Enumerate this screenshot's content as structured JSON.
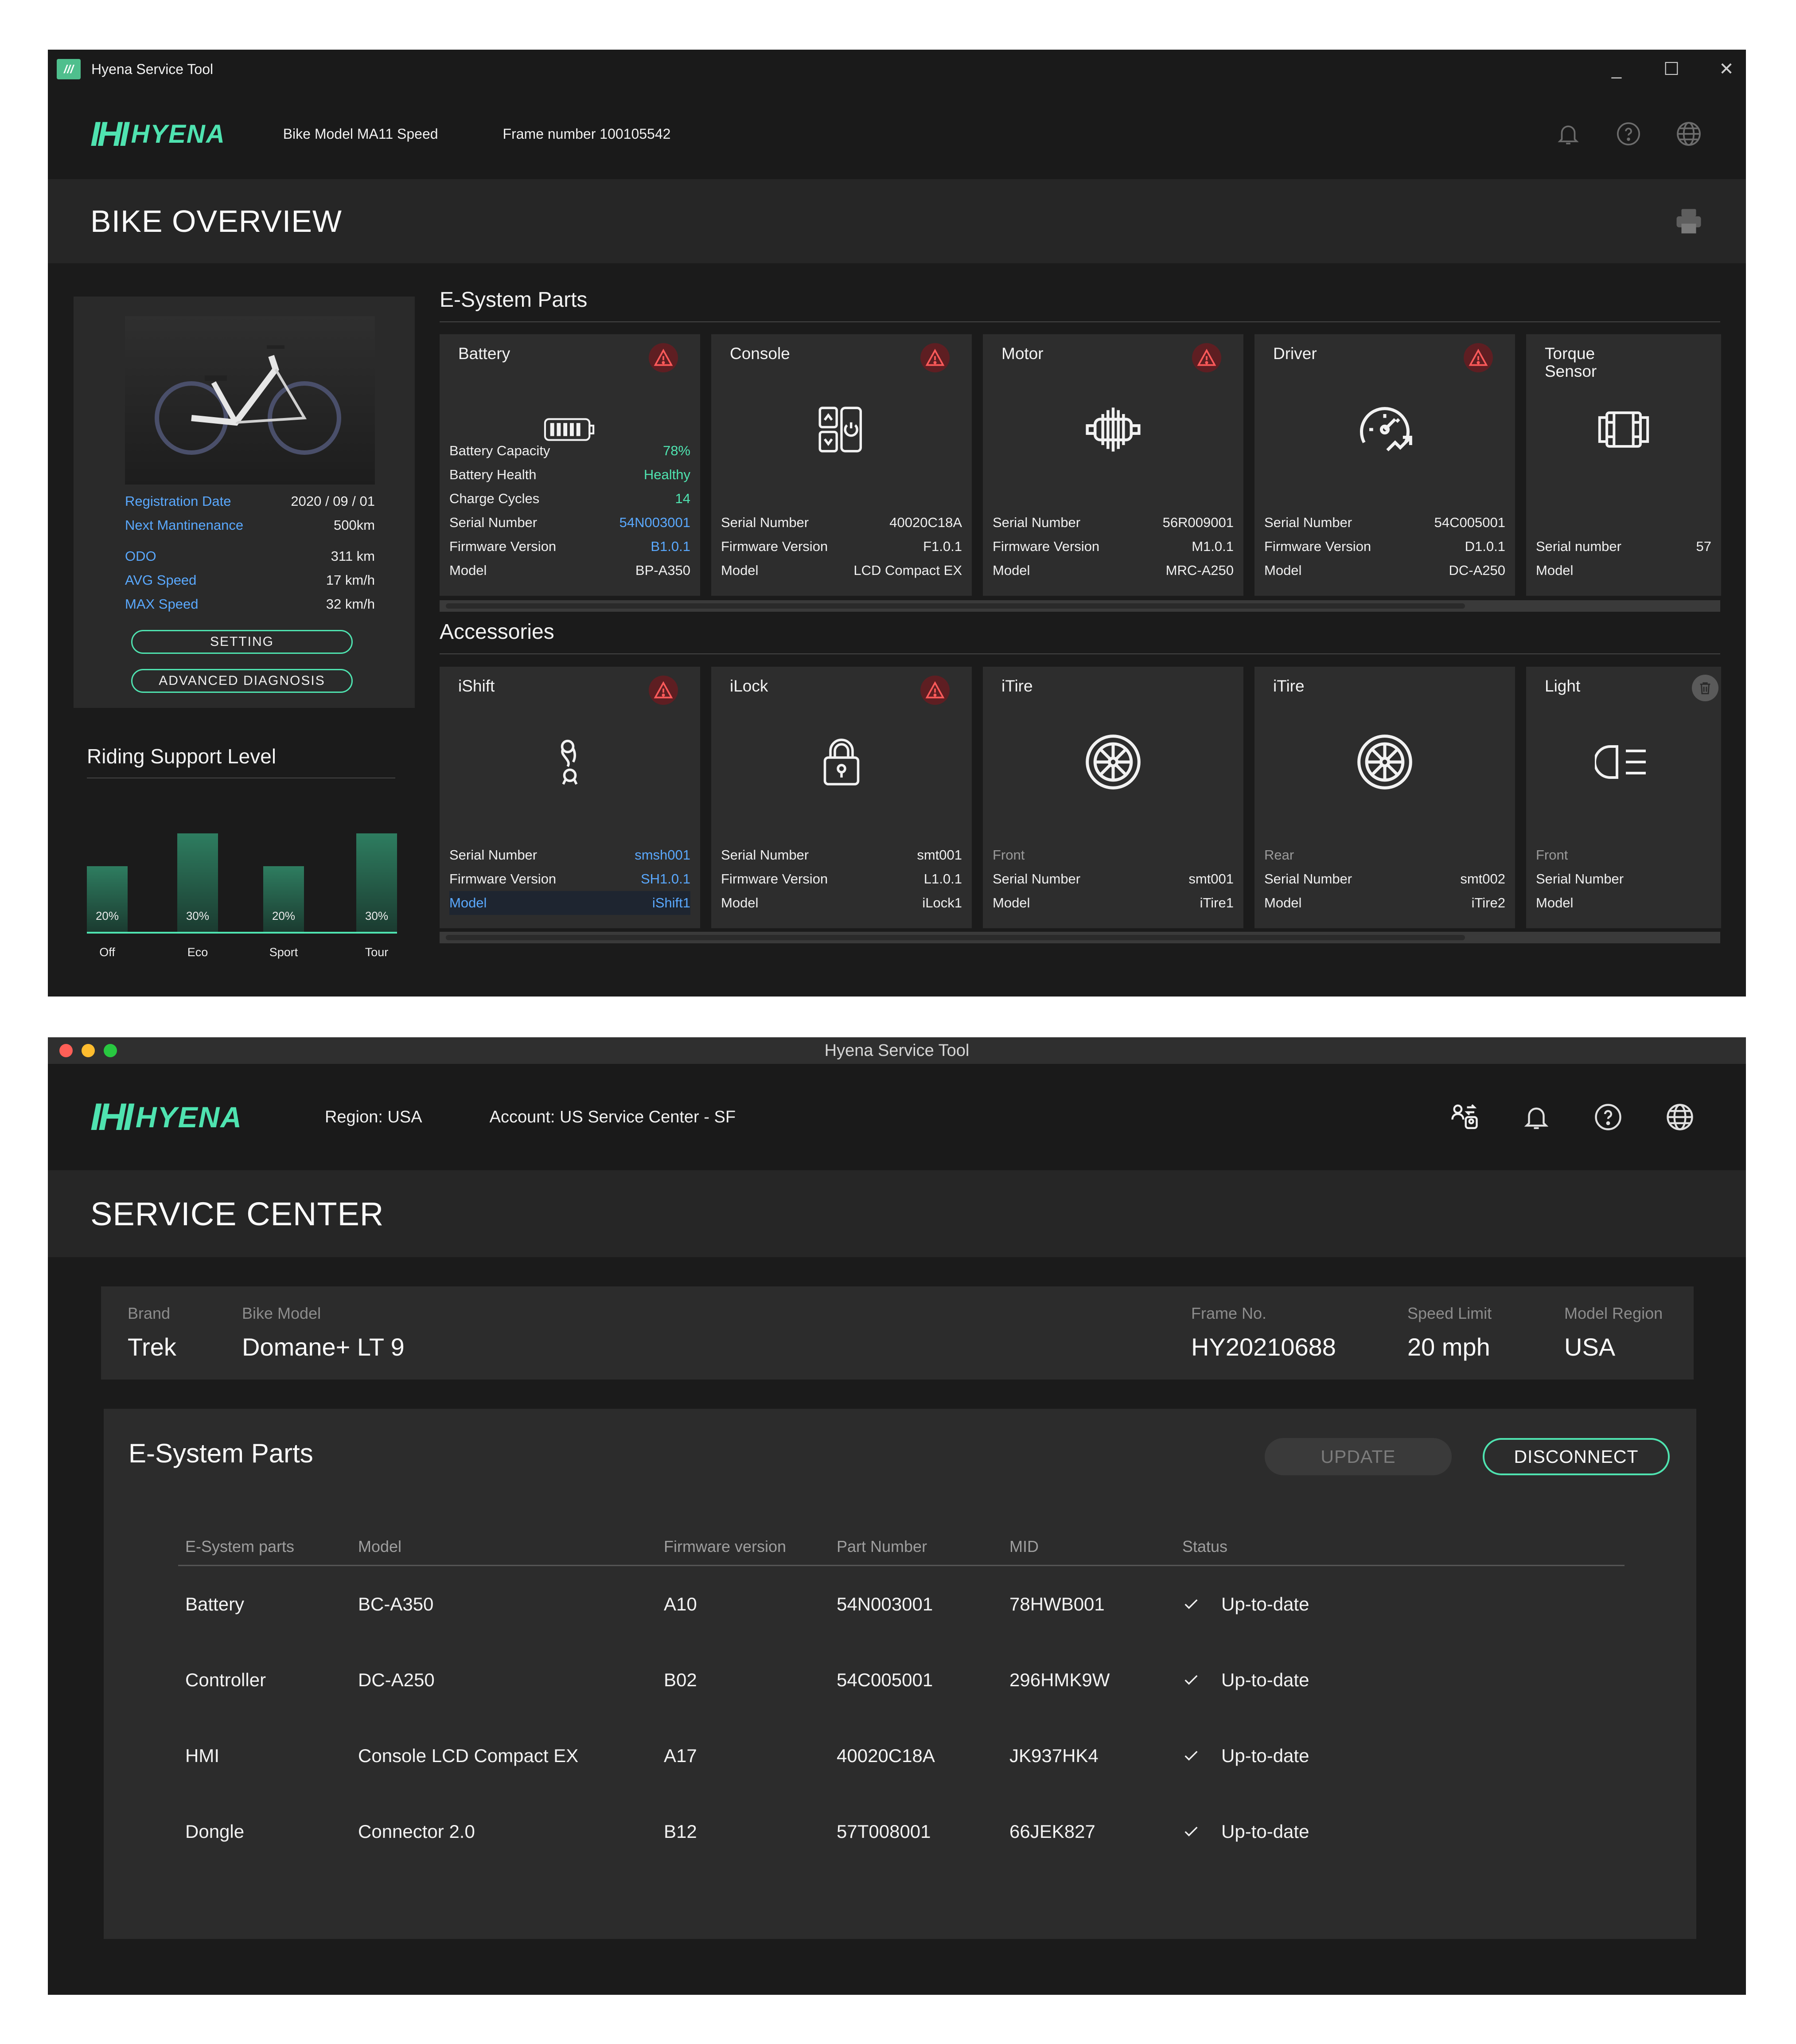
{
  "overview": {
    "titlebar": {
      "title": "Hyena Service Tool",
      "minimize": "_",
      "maximize": "☐",
      "close": "✕"
    },
    "header": {
      "brand_mark": "IHI",
      "brand_name": "HYENA",
      "bike_model": "Bike Model MA11 Speed",
      "frame_number": "Frame number 100105542"
    },
    "page_title": "BIKE OVERVIEW",
    "bike_info": {
      "registration_label": "Registration Date",
      "registration_value": "2020 / 09 / 01",
      "maintenance_label": "Next Mantinenance",
      "maintenance_value": "500km",
      "odo_label": "ODO",
      "odo_value": "311 km",
      "avg_label": "AVG Speed",
      "avg_value": "17 km/h",
      "max_label": "MAX Speed",
      "max_value": "32 km/h",
      "setting_label": "SETTING",
      "advanced_label": "ADVANCED  DIAGNOSIS"
    },
    "riding_support": {
      "title": "Riding Support Level",
      "levels": [
        {
          "label": "Off",
          "pct": "20%",
          "value": 20
        },
        {
          "label": "Eco",
          "pct": "30%",
          "value": 30
        },
        {
          "label": "Sport",
          "pct": "20%",
          "value": 20
        },
        {
          "label": "Tour",
          "pct": "30%",
          "value": 30
        }
      ]
    },
    "esystem": {
      "title": "E-System Parts",
      "cards": [
        {
          "name": "Battery",
          "icon": "battery-icon",
          "warning": true,
          "rows": [
            {
              "k": "Battery Capacity",
              "v": "78%",
              "style": "t"
            },
            {
              "k": "Battery Health",
              "v": "Healthy",
              "style": "t"
            },
            {
              "k": "Charge Cycles",
              "v": "14",
              "style": "t"
            },
            {
              "k": "Serial Number",
              "v": "54N003001",
              "style": "b"
            },
            {
              "k": "Firmware Version",
              "v": "B1.0.1",
              "style": "b"
            },
            {
              "k": "Model",
              "v": "BP-A350",
              "style": ""
            }
          ]
        },
        {
          "name": "Console",
          "icon": "console-icon",
          "warning": true,
          "rows": [
            {
              "k": "Serial Number",
              "v": "40020C18A",
              "style": ""
            },
            {
              "k": "Firmware Version",
              "v": "F1.0.1",
              "style": ""
            },
            {
              "k": "Model",
              "v": "LCD Compact EX",
              "style": ""
            }
          ]
        },
        {
          "name": "Motor",
          "icon": "motor-icon",
          "warning": true,
          "rows": [
            {
              "k": "Serial Number",
              "v": "56R009001",
              "style": ""
            },
            {
              "k": "Firmware Version",
              "v": "M1.0.1",
              "style": ""
            },
            {
              "k": "Model",
              "v": "MRC-A250",
              "style": ""
            }
          ]
        },
        {
          "name": "Driver",
          "icon": "speedometer-icon",
          "warning": true,
          "rows": [
            {
              "k": "Serial Number",
              "v": "54C005001",
              "style": ""
            },
            {
              "k": "Firmware Version",
              "v": "D1.0.1",
              "style": ""
            },
            {
              "k": "Model",
              "v": "DC-A250",
              "style": ""
            }
          ]
        },
        {
          "name": "Torque\nSensor",
          "icon": "torque-sensor-icon",
          "warning": false,
          "rows": [
            {
              "k": "Serial number",
              "v": "57",
              "style": ""
            },
            {
              "k": "Model",
              "v": "",
              "style": ""
            }
          ]
        }
      ]
    },
    "accessories": {
      "title": "Accessories",
      "cards": [
        {
          "name": "iShift",
          "icon": "derailleur-icon",
          "warning": true,
          "sub": "",
          "rows": [
            {
              "k": "Serial Number",
              "v": "smsh001",
              "style": "b"
            },
            {
              "k": "Firmware Version",
              "v": "SH1.0.1",
              "style": "b"
            },
            {
              "k": "Model",
              "v": "iShift1",
              "style": "kb",
              "sel": true
            }
          ]
        },
        {
          "name": "iLock",
          "icon": "lock-icon",
          "warning": true,
          "sub": "",
          "rows": [
            {
              "k": "Serial Number",
              "v": "smt001",
              "style": ""
            },
            {
              "k": "Firmware Version",
              "v": "L1.0.1",
              "style": ""
            },
            {
              "k": "Model",
              "v": "iLock1",
              "style": ""
            }
          ]
        },
        {
          "name": "iTire",
          "icon": "wheel-icon",
          "warning": false,
          "sub": "Front",
          "rows": [
            {
              "k": "Serial Number",
              "v": "smt001",
              "style": ""
            },
            {
              "k": "Model",
              "v": "iTire1",
              "style": ""
            }
          ]
        },
        {
          "name": "iTire",
          "icon": "wheel-icon",
          "warning": false,
          "sub": "Rear",
          "rows": [
            {
              "k": "Serial Number",
              "v": "smt002",
              "style": ""
            },
            {
              "k": "Model",
              "v": "iTire2",
              "style": ""
            }
          ]
        },
        {
          "name": "Light",
          "icon": "headlight-icon",
          "warning": false,
          "delete": true,
          "sub": "Front",
          "rows": [
            {
              "k": "Serial Number",
              "v": "",
              "style": ""
            },
            {
              "k": "Model",
              "v": "",
              "style": ""
            }
          ]
        }
      ]
    }
  },
  "service": {
    "titlebar": {
      "title": "Hyena Service Tool"
    },
    "header": {
      "brand_mark": "IHI",
      "brand_name": "HYENA",
      "region": "Region: USA",
      "account": "Account: US Service Center - SF"
    },
    "page_title": "SERVICE CENTER",
    "bike": {
      "brand_label": "Brand",
      "brand_value": "Trek",
      "model_label": "Bike Model",
      "model_value": "Domane+ LT 9",
      "frame_label": "Frame No.",
      "frame_value": "HY20210688",
      "speed_label": "Speed Limit",
      "speed_value": "20 mph",
      "region_label": "Model Region",
      "region_value": "USA"
    },
    "parts": {
      "title": "E-System Parts",
      "update_label": "UPDATE",
      "disconnect_label": "DISCONNECT",
      "columns": [
        "E-System parts",
        "Model",
        "Firmware version",
        "Part Number",
        "MID",
        "Status"
      ],
      "rows": [
        [
          "Battery",
          "BC-A350",
          "A10",
          "54N003001",
          "78HWB001",
          "Up-to-date"
        ],
        [
          "Controller",
          "DC-A250",
          "B02",
          "54C005001",
          "296HMK9W",
          "Up-to-date"
        ],
        [
          "HMI",
          "Console LCD Compact EX",
          "A17",
          "40020C18A",
          "JK937HK4",
          "Up-to-date"
        ],
        [
          "Dongle",
          "Connector 2.0",
          "B12",
          "57T008001",
          "66JEK827",
          "Up-to-date"
        ]
      ]
    }
  },
  "colors": {
    "accent": "#4fe3b0",
    "link": "#5aa9ff",
    "warning": "#e74c4c"
  }
}
